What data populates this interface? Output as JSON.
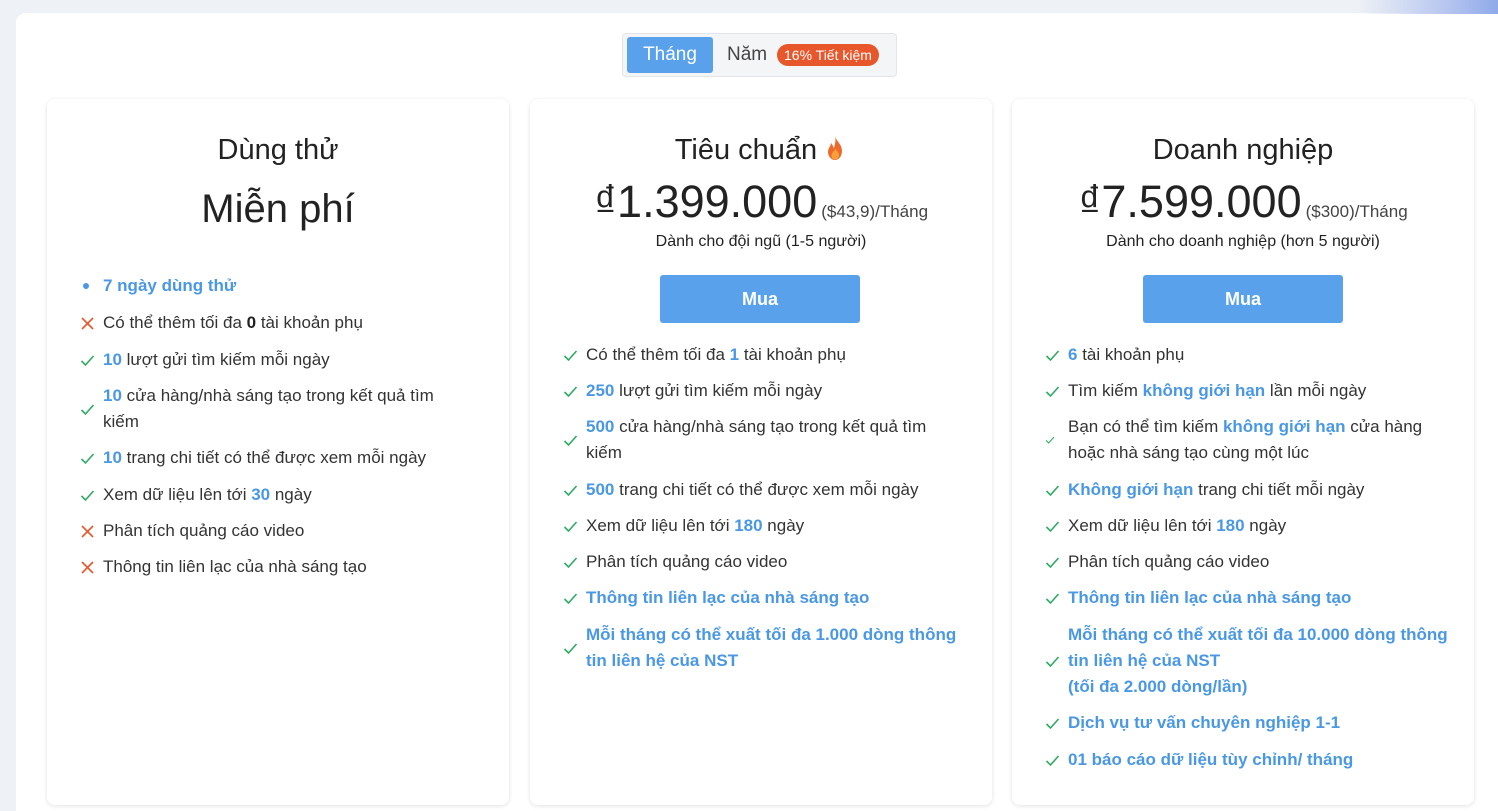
{
  "billing_toggle": {
    "month_label": "Tháng",
    "year_label": "Năm",
    "save_badge": "16% Tiết kiệm"
  },
  "colors": {
    "accent": "#5aa1ec",
    "highlight_text": "#4a98e5",
    "badge": "#e8572b",
    "check": "#2eaa63",
    "cross": "#e8572b"
  },
  "plans": [
    {
      "name": "Dùng thử",
      "price": "Miễn phí",
      "features": [
        {
          "icon": "bullet-icon",
          "segments": [
            {
              "t": "7 ngày dùng thử",
              "s": "bluebold"
            }
          ]
        },
        {
          "icon": "cross-icon",
          "segments": [
            {
              "t": "Có thể thêm tối đa "
            },
            {
              "t": "0",
              "s": "bold-dark"
            },
            {
              "t": " tài khoản phụ"
            }
          ]
        },
        {
          "icon": "check-icon",
          "segments": [
            {
              "t": "10",
              "s": "hl"
            },
            {
              "t": " lượt gửi tìm kiếm mỗi ngày"
            }
          ]
        },
        {
          "icon": "check-icon",
          "segments": [
            {
              "t": "10",
              "s": "hl"
            },
            {
              "t": " cửa hàng/nhà sáng tạo trong kết quả tìm kiếm"
            }
          ]
        },
        {
          "icon": "check-icon",
          "segments": [
            {
              "t": "10",
              "s": "hl"
            },
            {
              "t": " trang chi tiết có thể được xem mỗi ngày"
            }
          ]
        },
        {
          "icon": "check-icon",
          "segments": [
            {
              "t": "Xem dữ liệu lên tới "
            },
            {
              "t": "30",
              "s": "hl"
            },
            {
              "t": " ngày"
            }
          ]
        },
        {
          "icon": "cross-icon",
          "segments": [
            {
              "t": "Phân tích quảng cáo video"
            }
          ]
        },
        {
          "icon": "cross-icon",
          "segments": [
            {
              "t": "Thông tin liên lạc của nhà sáng tạo"
            }
          ]
        }
      ]
    },
    {
      "name": "Tiêu chuẩn",
      "price": "₫1.399.000",
      "price_sub": "($43,9)/Tháng",
      "audience": "Dành cho đội ngũ (1-5 người)",
      "buy_label": "Mua",
      "features": [
        {
          "icon": "check-icon",
          "segments": [
            {
              "t": "Có thể thêm tối đa "
            },
            {
              "t": "1",
              "s": "hl"
            },
            {
              "t": " tài khoản phụ"
            }
          ]
        },
        {
          "icon": "check-icon",
          "segments": [
            {
              "t": "250",
              "s": "hl"
            },
            {
              "t": " lượt gửi tìm kiếm mỗi ngày"
            }
          ]
        },
        {
          "icon": "check-icon",
          "segments": [
            {
              "t": "500",
              "s": "hl"
            },
            {
              "t": " cửa hàng/nhà sáng tạo trong kết quả tìm kiếm"
            }
          ]
        },
        {
          "icon": "check-icon",
          "segments": [
            {
              "t": "500",
              "s": "hl"
            },
            {
              "t": " trang chi tiết có thể được xem mỗi ngày"
            }
          ]
        },
        {
          "icon": "check-icon",
          "segments": [
            {
              "t": "Xem dữ liệu lên tới "
            },
            {
              "t": "180",
              "s": "hl"
            },
            {
              "t": " ngày"
            }
          ]
        },
        {
          "icon": "check-icon",
          "segments": [
            {
              "t": "Phân tích quảng cáo video"
            }
          ]
        },
        {
          "icon": "check-icon",
          "segments": [
            {
              "t": "Thông tin liên lạc của nhà sáng tạo",
              "s": "bluebold"
            }
          ]
        },
        {
          "icon": "check-icon",
          "segments": [
            {
              "t": "Mỗi tháng có thể xuất tối đa 1.000 dòng thông tin liên hệ của NST",
              "s": "bluebold"
            }
          ]
        }
      ]
    },
    {
      "name": "Doanh nghiệp",
      "price": "₫7.599.000",
      "price_sub": "($300)/Tháng",
      "audience": "Dành cho doanh nghiệp (hơn 5 người)",
      "buy_label": "Mua",
      "features": [
        {
          "icon": "check-icon",
          "segments": [
            {
              "t": "6",
              "s": "hl"
            },
            {
              "t": " tài khoản phụ"
            }
          ]
        },
        {
          "icon": "check-icon",
          "segments": [
            {
              "t": "Tìm kiếm "
            },
            {
              "t": "không giới hạn",
              "s": "hl"
            },
            {
              "t": " lần mỗi ngày"
            }
          ]
        },
        {
          "icon": "check-small-icon",
          "segments": [
            {
              "t": "Bạn có thể tìm kiếm "
            },
            {
              "t": "không giới hạn",
              "s": "hl"
            },
            {
              "t": " cửa hàng hoặc nhà sáng tạo cùng một lúc"
            }
          ]
        },
        {
          "icon": "check-icon",
          "segments": [
            {
              "t": "Không giới hạn",
              "s": "hl"
            },
            {
              "t": " trang chi tiết mỗi ngày"
            }
          ]
        },
        {
          "icon": "check-icon",
          "segments": [
            {
              "t": "Xem dữ liệu lên tới "
            },
            {
              "t": "180",
              "s": "hl"
            },
            {
              "t": " ngày"
            }
          ]
        },
        {
          "icon": "check-icon",
          "segments": [
            {
              "t": "Phân tích quảng cáo video"
            }
          ]
        },
        {
          "icon": "check-icon",
          "segments": [
            {
              "t": "Thông tin liên lạc của nhà sáng tạo",
              "s": "bluebold"
            }
          ]
        },
        {
          "icon": "check-icon",
          "segments": [
            {
              "t": "Mỗi tháng có thể xuất tối đa 10.000 dòng thông tin liên hệ của NST",
              "s": "bluebold"
            },
            {
              "br": true
            },
            {
              "t": "(tối đa 2.000 dòng/lần)",
              "s": "bluebold"
            }
          ]
        },
        {
          "icon": "check-icon",
          "segments": [
            {
              "t": "Dịch vụ tư vấn chuyên nghiệp 1-1",
              "s": "bluebold"
            }
          ]
        },
        {
          "icon": "check-icon",
          "segments": [
            {
              "t": "01 báo cáo dữ liệu tùy chỉnh/ tháng",
              "s": "bluebold"
            }
          ]
        }
      ]
    }
  ]
}
